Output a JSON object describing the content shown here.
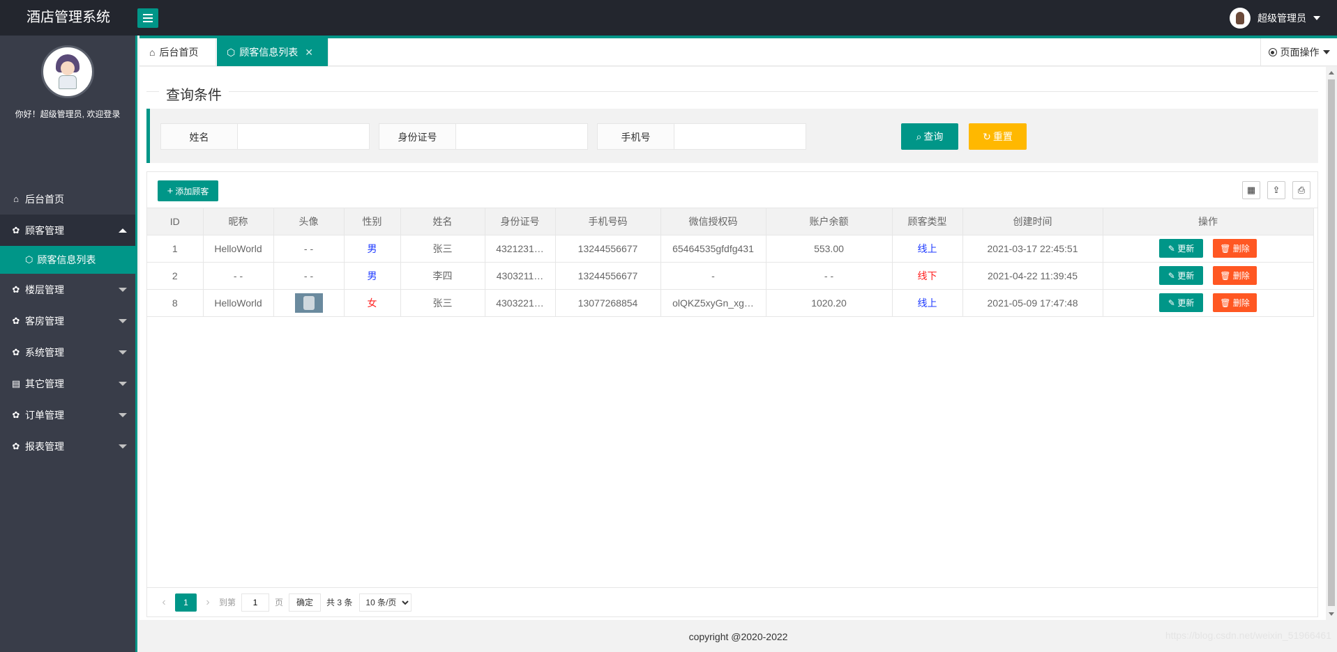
{
  "app": {
    "title": "酒店管理系统"
  },
  "header": {
    "user_name": "超级管理员"
  },
  "sidebar": {
    "welcome": "你好！超级管理员, 欢迎登录",
    "items": [
      {
        "label": "后台首页",
        "icon": "home-icon"
      },
      {
        "label": "顾客管理",
        "icon": "gear-icon",
        "expanded": true
      },
      {
        "label": "楼层管理",
        "icon": "gear-icon"
      },
      {
        "label": "客房管理",
        "icon": "gear-icon"
      },
      {
        "label": "系统管理",
        "icon": "gear-icon"
      },
      {
        "label": "其它管理",
        "icon": "clipboard-icon"
      },
      {
        "label": "订单管理",
        "icon": "gear-icon"
      },
      {
        "label": "报表管理",
        "icon": "gear-icon"
      }
    ],
    "sub_item": {
      "label": "顾客信息列表",
      "icon": "cube-icon"
    }
  },
  "tabs": {
    "home": "后台首页",
    "active": "顾客信息列表",
    "page_ops": "页面操作"
  },
  "search": {
    "legend": "查询条件",
    "fields": [
      {
        "label": "姓名",
        "value": ""
      },
      {
        "label": "身份证号",
        "value": ""
      },
      {
        "label": "手机号",
        "value": ""
      }
    ],
    "query_label": "查询",
    "reset_label": "重置"
  },
  "table": {
    "add_label": "添加顾客",
    "columns": [
      "ID",
      "昵称",
      "头像",
      "性别",
      "姓名",
      "身份证号",
      "手机号码",
      "微信授权码",
      "账户余额",
      "顾客类型",
      "创建时间",
      "操作"
    ],
    "rows": [
      {
        "id": "1",
        "nickname": "HelloWorld",
        "avatar": "- -",
        "gender": "男",
        "name": "张三",
        "idcard": "4321231…",
        "phone": "13244556677",
        "wechat": "65464535gfdfg431",
        "balance": "553.00",
        "type": "线上",
        "created": "2021-03-17 22:45:51"
      },
      {
        "id": "2",
        "nickname": "- -",
        "avatar": "- -",
        "gender": "男",
        "name": "李四",
        "idcard": "4303211…",
        "phone": "13244556677",
        "wechat": "-",
        "balance": "- -",
        "type": "线下",
        "created": "2021-04-22 11:39:45"
      },
      {
        "id": "8",
        "nickname": "HelloWorld",
        "avatar": "",
        "gender": "女",
        "name": "张三",
        "idcard": "4303221…",
        "phone": "13077268854",
        "wechat": "olQKZ5xyGn_xg…",
        "balance": "1020.20",
        "type": "线上",
        "created": "2021-05-09 17:47:48"
      }
    ],
    "update_label": "更新",
    "delete_label": "删除"
  },
  "pager": {
    "current": "1",
    "goto_label": "到第",
    "page_input": "1",
    "page_unit": "页",
    "confirm_label": "确定",
    "total": "共 3 条",
    "page_size": "10 条/页"
  },
  "footer": {
    "copyright": "copyright @2020-2022"
  },
  "watermark": "https://blog.csdn.net/weixin_51966461",
  "colors": {
    "accent": "#009688",
    "warning": "#ffb800",
    "danger": "#ff5722",
    "sidebar_bg": "#393d49",
    "header_bg": "#23262e"
  }
}
